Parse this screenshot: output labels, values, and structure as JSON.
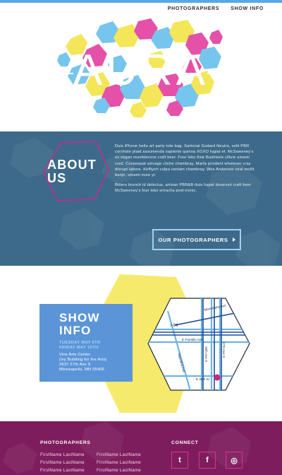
{
  "nav": {
    "items": [
      "PHOTOGRAPHERS",
      "SHOW INFO"
    ]
  },
  "logo": {
    "text": "AURA"
  },
  "about": {
    "title_line1": "ABOUT",
    "title_line2": "US",
    "paragraph1": "Duis iPhone hella art party tote bag. Sartorial Godard Neutra, velit PBR cornhole plaid assumenda sapiente quinoa XOXO fugiat et. McSweeney's ex vegan mumblecore craft beer. Four loko fixie Bushwick cillum umami cred. Consequat selvage cliche chambray, Marfa proident whatever cray disrupt labore. Keffiyeh culpa veniam chambray. Wes Anderson viral mollit banjo, umami esse yr.",
    "paragraph2": "Bitters brunch id delectus, artisan PBR&B duis fugiat deserunt craft beer McSweeney's four loko sriracha post-ironic.",
    "button_label": "OUR PHOTOGRAPHERS"
  },
  "show": {
    "title_line1": "SHOW",
    "title_line2": "INFO",
    "date1": "TUESDAY MAY 6TH",
    "date2": "FRIDAY MAY 10TH",
    "venue_line1": "Vine Arts Center",
    "venue_line2": "(Ivy Building for the Arts)",
    "venue_line3": "2637 27th Ave S",
    "venue_line4": "Minneapolis, MN 55406"
  },
  "map": {
    "labels": {
      "minnehaha": "Minnehaha Ave",
      "i94": "I-94",
      "franklin": "E Franklin Ave",
      "ave26": "26th Ave S",
      "ave27": "27th Ave S",
      "st26": "E 26th St",
      "hiawatha": "Hiawatha Ave"
    }
  },
  "footer": {
    "photographers_heading": "PHOTOGRAPHERS",
    "connect_heading": "CONNECT",
    "col1": [
      "FirstName LastName",
      "FirstName LastName",
      "FirstName LastName"
    ],
    "col2": [
      "FirstName LastName",
      "FirstName LastName",
      "FirstName LastName"
    ],
    "social": [
      {
        "icon": "twitter-icon",
        "glyph": "t"
      },
      {
        "icon": "facebook-icon",
        "glyph": "f"
      },
      {
        "icon": "instagram-icon",
        "glyph": "◎"
      }
    ]
  },
  "colors": {
    "accent_blue": "#5aa7e6",
    "about_bg": "#3d6a8a",
    "hex_magenta": "#d6248b",
    "show_blue": "#5b95d8",
    "highlight_yellow": "#f5ea6b",
    "footer_bg": "#7e1d5d"
  }
}
